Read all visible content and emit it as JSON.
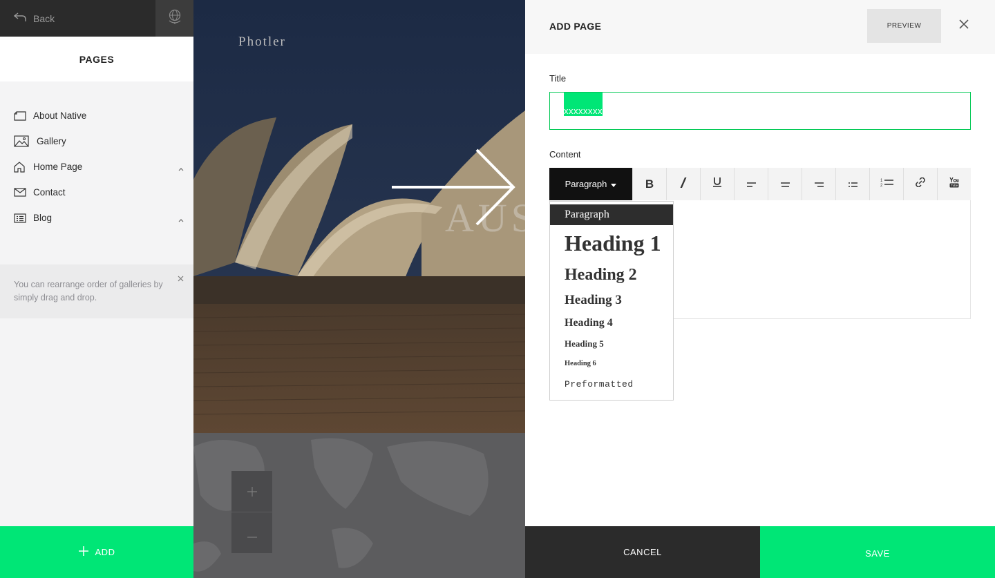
{
  "sidebar": {
    "back_label": "Back",
    "header": "PAGES",
    "items": [
      {
        "label": "About Native",
        "icon": "page-icon"
      },
      {
        "label": "Gallery",
        "icon": "image-icon"
      },
      {
        "label": "Home Page",
        "icon": "home-icon",
        "expandable": true
      },
      {
        "label": "Contact",
        "icon": "mail-icon"
      },
      {
        "label": "Blog",
        "icon": "list-icon",
        "expandable": true
      }
    ],
    "tip": "You can rearrange order of galleries by simply drag and drop.",
    "add_label": "ADD"
  },
  "preview": {
    "site_name": "Photler",
    "hero_text": "AUS"
  },
  "panel": {
    "title": "ADD PAGE",
    "preview_label": "PREVIEW",
    "title_field_label": "Title",
    "title_value": "xxxxxxxx",
    "content_label": "Content",
    "format_selected": "Paragraph",
    "toolbar_icons": [
      "bold-icon",
      "italic-icon",
      "underline-icon",
      "align-left-icon",
      "align-center-icon",
      "align-right-icon",
      "bullet-list-icon",
      "numbered-list-icon",
      "link-icon",
      "youtube-icon"
    ],
    "format_options": [
      "Paragraph",
      "Heading 1",
      "Heading 2",
      "Heading 3",
      "Heading 4",
      "Heading 5",
      "Heading 6",
      "Preformatted"
    ],
    "cancel_label": "CANCEL",
    "save_label": "SAVE"
  },
  "colors": {
    "accent": "#00e676",
    "dark": "#2b2b2b"
  }
}
